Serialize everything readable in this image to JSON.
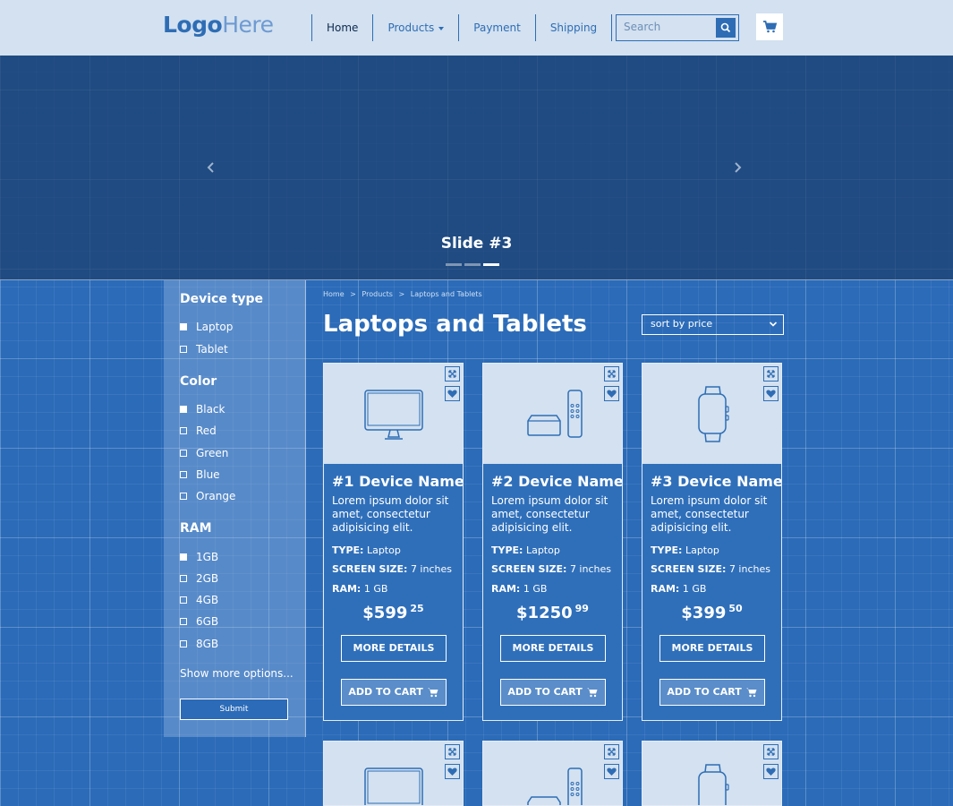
{
  "header": {
    "logo_bold": "Logo",
    "logo_light": "Here",
    "nav": [
      {
        "label": "Home"
      },
      {
        "label": "Products"
      },
      {
        "label": "Payment"
      },
      {
        "label": "Shipping"
      }
    ],
    "search_placeholder": "Search"
  },
  "hero": {
    "slide_title": "Slide #3",
    "slides_total": 3,
    "active_slide": 3
  },
  "sidebar": {
    "groups": [
      {
        "title": "Device type",
        "options": [
          {
            "label": "Laptop",
            "checked": true
          },
          {
            "label": "Tablet",
            "checked": false
          }
        ]
      },
      {
        "title": "Color",
        "options": [
          {
            "label": "Black",
            "checked": true
          },
          {
            "label": "Red",
            "checked": false
          },
          {
            "label": "Green",
            "checked": false
          },
          {
            "label": "Blue",
            "checked": false
          },
          {
            "label": "Orange",
            "checked": false
          }
        ]
      },
      {
        "title": "RAM",
        "options": [
          {
            "label": "1GB",
            "checked": true
          },
          {
            "label": "2GB",
            "checked": false
          },
          {
            "label": "4GB",
            "checked": false
          },
          {
            "label": "6GB",
            "checked": false
          },
          {
            "label": "8GB",
            "checked": false
          }
        ]
      }
    ],
    "show_more": "Show more options...",
    "submit": "Submit"
  },
  "breadcrumb": {
    "home": "Home",
    "sep": ">",
    "products": "Products",
    "current": "Laptops and Tablets"
  },
  "page_title": "Laptops and Tablets",
  "sort_label": "sort by price",
  "labels": {
    "type": "TYPE:",
    "screen": "SCREEN SIZE:",
    "ram": "RAM:",
    "more": "MORE DETAILS",
    "add": "ADD TO CART"
  },
  "products": [
    {
      "name": "#1 Device Name",
      "desc": "Lorem ipsum dolor sit amet, consectetur adipisicing elit.",
      "type": "Laptop",
      "screen": "7 inches",
      "ram": "1 GB",
      "price_main": "$599",
      "price_cents": "25",
      "icon": "monitor-icon"
    },
    {
      "name": "#2 Device Name",
      "desc": "Lorem ipsum dolor sit amet, consectetur adipisicing elit.",
      "type": "Laptop",
      "screen": "7 inches",
      "ram": "1 GB",
      "price_main": "$1250",
      "price_cents": "99",
      "icon": "tv-box-icon"
    },
    {
      "name": "#3 Device Name",
      "desc": "Lorem ipsum dolor sit amet, consectetur adipisicing elit.",
      "type": "Laptop",
      "screen": "7 inches",
      "ram": "1 GB",
      "price_main": "$399",
      "price_cents": "50",
      "icon": "smartwatch-icon"
    }
  ],
  "colors": {
    "accent": "#2e6db5",
    "header_bg": "#d3e1f0",
    "page_bg": "#2b6bb8"
  }
}
